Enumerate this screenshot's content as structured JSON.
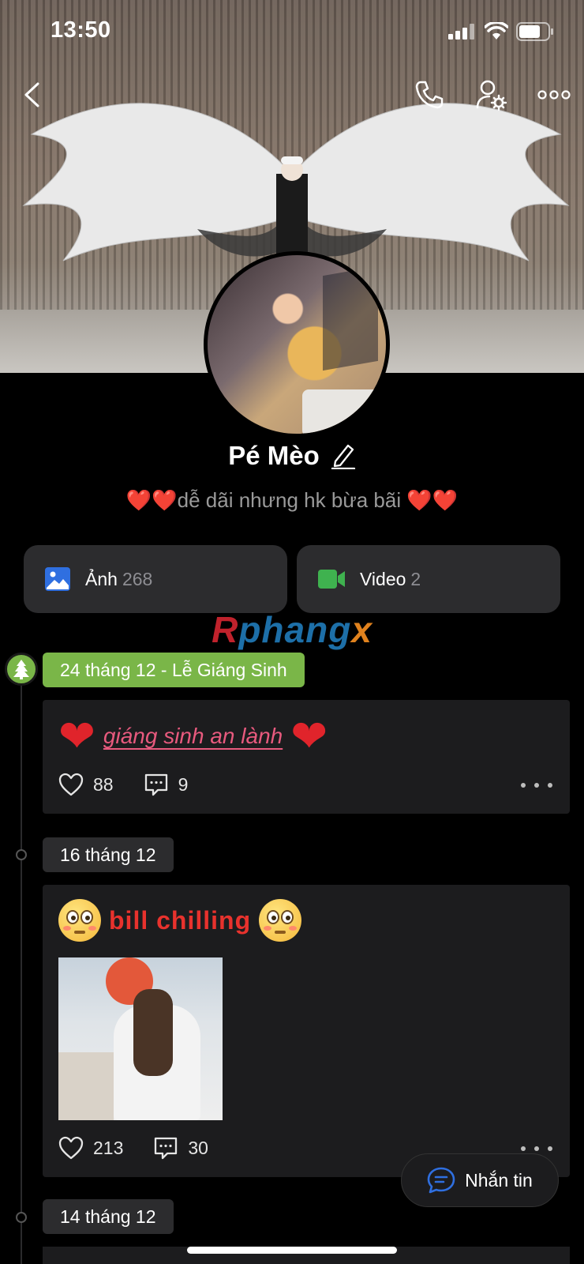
{
  "status_bar": {
    "time": "13:50"
  },
  "profile": {
    "name": "Pé Mèo",
    "bio_text": "dễ dãi nhưng hk bừa bãi",
    "bio_prefix_hearts": "❤️❤️",
    "bio_suffix_hearts": "❤️❤️"
  },
  "media": {
    "photos": {
      "label": "Ảnh",
      "count": "268"
    },
    "videos": {
      "label": "Video",
      "count": "2"
    }
  },
  "watermark": {
    "part1": "R",
    "part2": "phang",
    "part3": "x"
  },
  "timeline": [
    {
      "date": "24 tháng 12 - Lễ Giáng Sinh",
      "holiday": true,
      "post": {
        "text": "giáng sinh an lành",
        "likes": "88",
        "comments": "9"
      }
    },
    {
      "date": "16 tháng 12",
      "holiday": false,
      "post": {
        "text": "bill chilling",
        "likes": "213",
        "comments": "30"
      }
    },
    {
      "date": "14 tháng 12",
      "holiday": false
    }
  ],
  "message_button": {
    "label": "Nhắn tin"
  },
  "colors": {
    "accent_green": "#7ab648",
    "photo_icon": "#2f6fe0",
    "video_icon": "#3fb24f",
    "message_icon": "#2f6fe0",
    "heart_red": "#e0242b"
  }
}
